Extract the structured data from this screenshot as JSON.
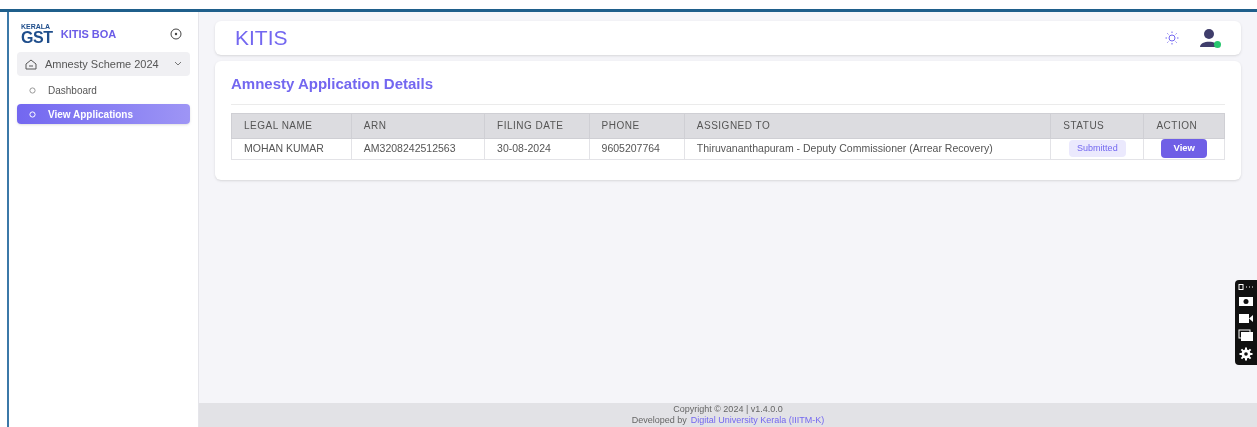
{
  "sidebar": {
    "logo": {
      "state": "KERALA",
      "mark": "GST"
    },
    "app_name": "KITIS BOA",
    "group": {
      "label": "Amnesty Scheme 2024",
      "expanded": true
    },
    "items": [
      {
        "label": "Dashboard",
        "selected": false
      },
      {
        "label": "View Applications",
        "selected": true
      }
    ]
  },
  "header": {
    "title": "KITIS",
    "user_online": true
  },
  "card": {
    "title": "Amnesty Application Details",
    "table": {
      "columns": [
        "LEGAL NAME",
        "ARN",
        "FILING DATE",
        "PHONE",
        "ASSIGNED TO",
        "STATUS",
        "ACTION"
      ],
      "rows": [
        {
          "legal_name": "MOHAN KUMAR",
          "arn": "AM3208242512563",
          "filing_date": "30-08-2024",
          "phone": "9605207764",
          "assigned_to": "Thiruvananthapuram - Deputy Commissioner (Arrear Recovery)",
          "status": "Submitted",
          "action": "View"
        }
      ]
    }
  },
  "footer": {
    "copyright": "Copyright © 2024 | v1.4.0.0",
    "developed_by": "Developed by",
    "developer_link": "Digital University Kerala (IIITM-K)"
  }
}
